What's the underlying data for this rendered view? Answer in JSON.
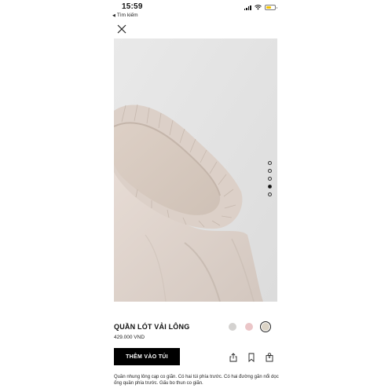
{
  "status_bar": {
    "time": "15:59",
    "back_label": "Tìm kiếm"
  },
  "product": {
    "name": "QUẦN LÓT VẢI LÔNG",
    "price": "429.000 VND",
    "add_to_cart_label": "THÊM VÀO TÚI",
    "description": "Quần nhung lông cạp co giãn. Có hai túi phía trước. Có hai đường găn nổi dọc ống quần phía trước. Gấu bo thun co giãn.",
    "colors": [
      {
        "name": "grey",
        "hex": "#d4d2d0"
      },
      {
        "name": "pink",
        "hex": "#ebc6c8"
      },
      {
        "name": "beige",
        "hex": "#dcd4c6"
      }
    ],
    "selected_color_index": 2,
    "image_count": 5,
    "active_image_index": 3
  },
  "icons": {
    "close": "close-icon",
    "share": "share-icon",
    "bookmark": "bookmark-icon",
    "bag": "bag-icon",
    "signal": "signal-icon",
    "wifi": "wifi-icon",
    "battery": "battery-icon"
  },
  "bag_count": "0",
  "accent": {
    "battery": "#f2c200",
    "button_bg": "#000000"
  }
}
